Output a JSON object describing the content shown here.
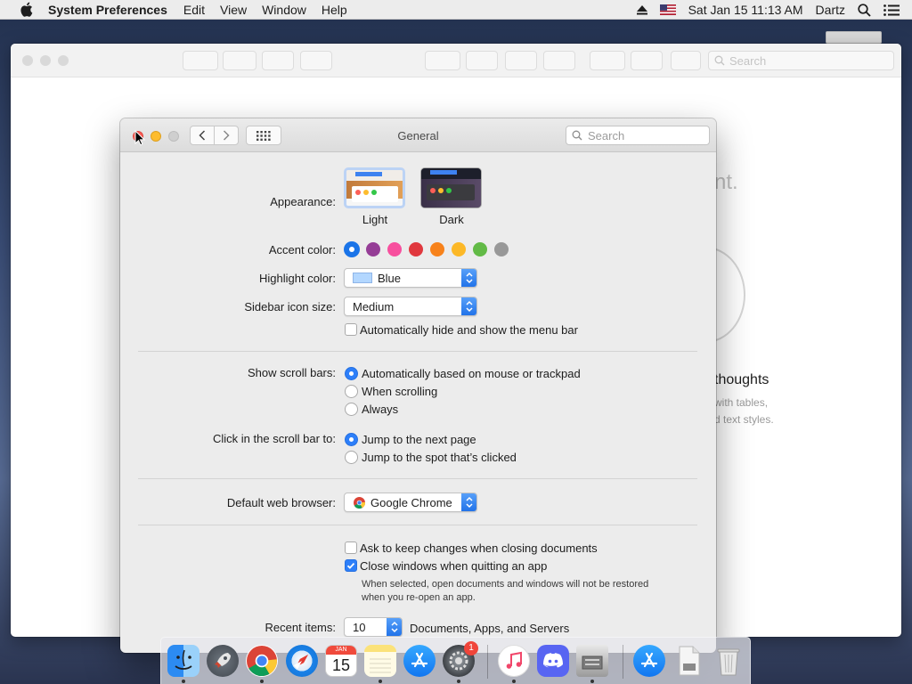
{
  "menubar": {
    "app_name": "System Preferences",
    "menus": [
      "Edit",
      "View",
      "Window",
      "Help"
    ],
    "clock": "Sat Jan 15  11:13 AM",
    "user": "Dartz"
  },
  "notes_window": {
    "search_placeholder": "Search",
    "bg_fragment_1": "nt.",
    "bg_heading": "thoughts",
    "bg_line_1": "with tables,",
    "bg_line_2": "d text styles."
  },
  "prefs": {
    "title": "General",
    "search_placeholder": "Search",
    "appearance": {
      "label": "Appearance:",
      "light": "Light",
      "dark": "Dark"
    },
    "accent_label": "Accent color:",
    "accent_colors": [
      "#1a74e8",
      "#953d96",
      "#f74f9e",
      "#e0383e",
      "#f7821b",
      "#fcb827",
      "#62ba46",
      "#989898"
    ],
    "highlight": {
      "label": "Highlight color:",
      "value": "Blue",
      "swatch": "#b3d7ff"
    },
    "sidebar_size": {
      "label": "Sidebar icon size:",
      "value": "Medium"
    },
    "auto_hide_menu": "Automatically hide and show the menu bar",
    "scroll_bars": {
      "label": "Show scroll bars:",
      "options": [
        "Automatically based on mouse or trackpad",
        "When scrolling",
        "Always"
      ]
    },
    "click_scroll": {
      "label": "Click in the scroll bar to:",
      "options": [
        "Jump to the next page",
        "Jump to the spot that’s clicked"
      ]
    },
    "browser": {
      "label": "Default web browser:",
      "value": "Google Chrome"
    },
    "ask_keep": "Ask to keep changes when closing documents",
    "close_windows": "Close windows when quitting an app",
    "close_note_1": "When selected, open documents and windows will not be restored",
    "close_note_2": "when you re-open an app.",
    "recent": {
      "label": "Recent items:",
      "value": "10",
      "suffix": "Documents, Apps, and Servers"
    }
  },
  "dock": {
    "calendar_month": "JAN",
    "calendar_day": "15",
    "badge": "1"
  }
}
